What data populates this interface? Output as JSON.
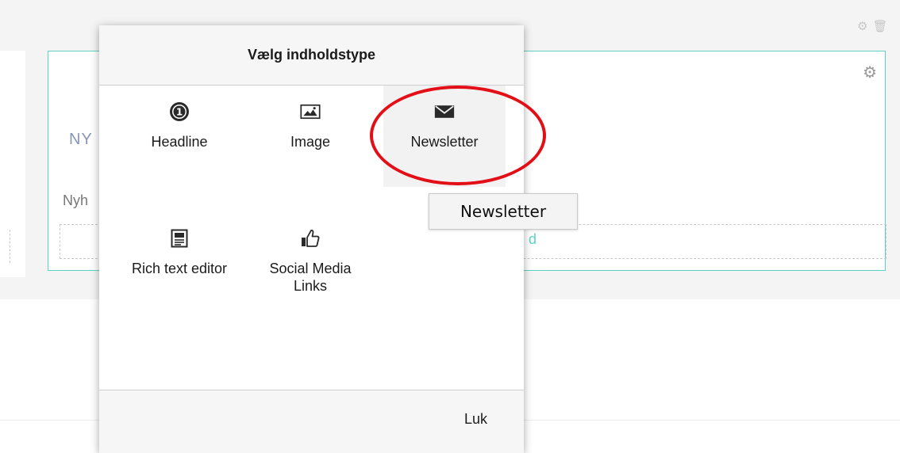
{
  "background": {
    "heading_fragment": "NY",
    "text_fragment": "Nyh",
    "add_fragment": "d",
    "row_icons": [
      "gear-icon",
      "trash-icon"
    ],
    "cell_icon": "gear-icon"
  },
  "dialog": {
    "title": "Vælg indholdstype",
    "items": [
      {
        "label": "Headline",
        "icon": "headline-icon"
      },
      {
        "label": "Image",
        "icon": "image-icon"
      },
      {
        "label": "Newsletter",
        "icon": "envelope-icon",
        "hovered": true
      },
      {
        "label": "Rich text editor",
        "icon": "rich-text-icon"
      },
      {
        "label": "Social Media Links",
        "icon": "thumbs-up-icon"
      }
    ],
    "close_label": "Luk"
  },
  "tooltip": {
    "text": "Newsletter"
  },
  "colors": {
    "accent": "#5fd2c6",
    "highlight": "#e30f16",
    "hover_bg": "#f2f2f3"
  }
}
